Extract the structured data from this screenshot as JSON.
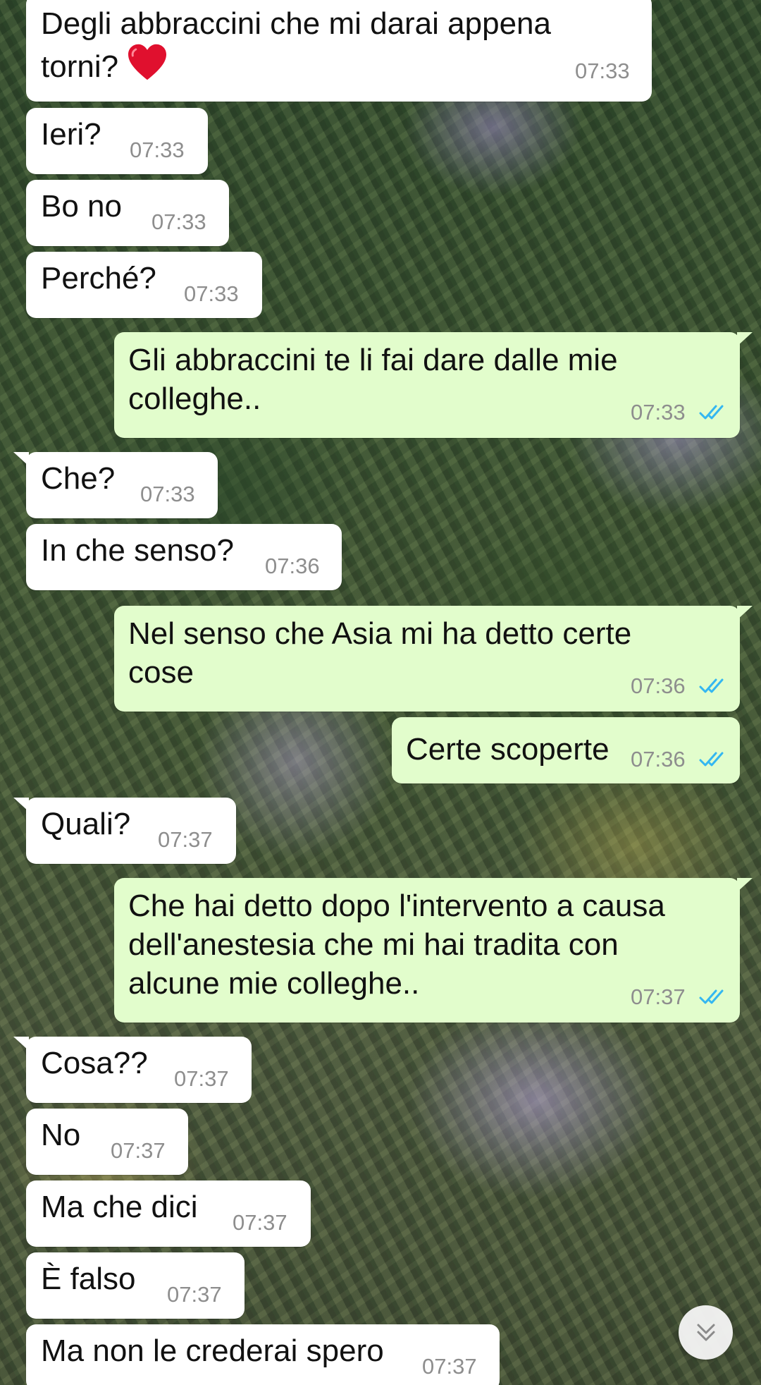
{
  "messages": [
    {
      "dir": "in",
      "lines": [
        "Degli abbraccini che mi darai appena",
        "torni?"
      ],
      "emoji": "heart",
      "time": "07:33"
    },
    {
      "dir": "in",
      "lines": [
        "Ieri?"
      ],
      "time": "07:33"
    },
    {
      "dir": "in",
      "lines": [
        "Bo no"
      ],
      "time": "07:33"
    },
    {
      "dir": "in",
      "lines": [
        "Perché?"
      ],
      "time": "07:33"
    },
    {
      "dir": "out",
      "lines": [
        "Gli abbraccini te li fai dare dalle mie",
        "colleghe.."
      ],
      "time": "07:33",
      "status": "read"
    },
    {
      "dir": "in",
      "lines": [
        "Che?"
      ],
      "time": "07:33"
    },
    {
      "dir": "in",
      "lines": [
        "In che senso?"
      ],
      "time": "07:36"
    },
    {
      "dir": "out",
      "lines": [
        "Nel senso che Asia mi ha detto certe",
        "cose"
      ],
      "time": "07:36",
      "status": "read"
    },
    {
      "dir": "out",
      "lines": [
        "Certe scoperte"
      ],
      "time": "07:36",
      "status": "read"
    },
    {
      "dir": "in",
      "lines": [
        "Quali?"
      ],
      "time": "07:37"
    },
    {
      "dir": "out",
      "lines": [
        "Che hai detto dopo l'intervento a causa",
        "dell'anestesia che mi hai tradita con",
        "alcune mie colleghe.."
      ],
      "time": "07:37",
      "status": "read"
    },
    {
      "dir": "in",
      "lines": [
        "Cosa??"
      ],
      "time": "07:37"
    },
    {
      "dir": "in",
      "lines": [
        "No"
      ],
      "time": "07:37"
    },
    {
      "dir": "in",
      "lines": [
        "Ma che dici"
      ],
      "time": "07:37"
    },
    {
      "dir": "in",
      "lines": [
        "È falso"
      ],
      "time": "07:37"
    },
    {
      "dir": "in",
      "lines": [
        "Ma non le crederai spero"
      ],
      "time": "07:37"
    }
  ],
  "colors": {
    "incoming_bubble": "#ffffff",
    "outgoing_bubble": "#e2fdcc",
    "timestamp": "#8e8e8e",
    "read_ticks": "#34b7f1"
  },
  "icons": {
    "read_status": "double-check-icon",
    "scroll": "chevron-double-down-icon"
  }
}
